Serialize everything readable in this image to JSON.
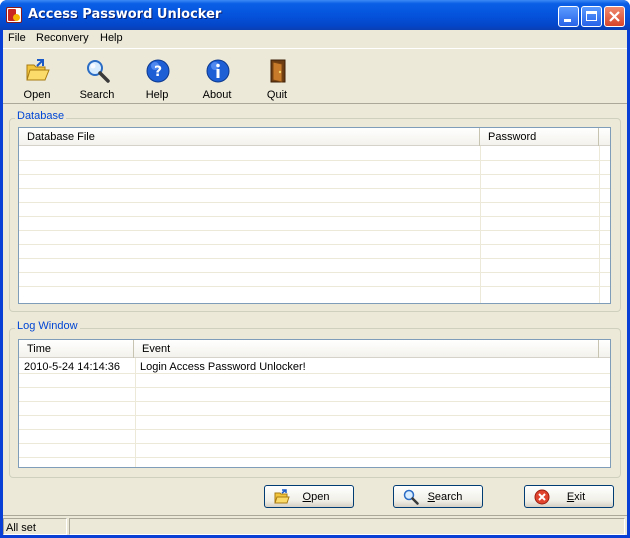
{
  "window": {
    "title": "Access Password Unlocker"
  },
  "menu": {
    "items": [
      "File",
      "Reconvery",
      "Help"
    ]
  },
  "toolbar": {
    "items": [
      {
        "label": "Open",
        "icon": "open-folder-icon"
      },
      {
        "label": "Search",
        "icon": "search-icon"
      },
      {
        "label": "Help",
        "icon": "help-icon"
      },
      {
        "label": "About",
        "icon": "info-icon"
      },
      {
        "label": "Quit",
        "icon": "door-exit-icon"
      }
    ]
  },
  "database": {
    "group_title": "Database",
    "columns": [
      "Database File",
      "Password"
    ],
    "rows": []
  },
  "log": {
    "group_title": "Log Window",
    "columns": [
      "Time",
      "Event"
    ],
    "rows": [
      {
        "time": "2010-5-24 14:14:36",
        "event": "Login Access Password Unlocker!"
      }
    ]
  },
  "buttons": {
    "open": {
      "label": "Open",
      "mnemonic": "O",
      "rest": "pen"
    },
    "search": {
      "label": "Search",
      "mnemonic": "S",
      "rest": "earch"
    },
    "exit": {
      "label": "Exit",
      "mnemonic": "E",
      "rest": "xit"
    }
  },
  "status": {
    "text": "All set"
  },
  "colors": {
    "title_bar": "#0553dc",
    "group_title": "#0046d5",
    "face": "#ece9d8"
  }
}
